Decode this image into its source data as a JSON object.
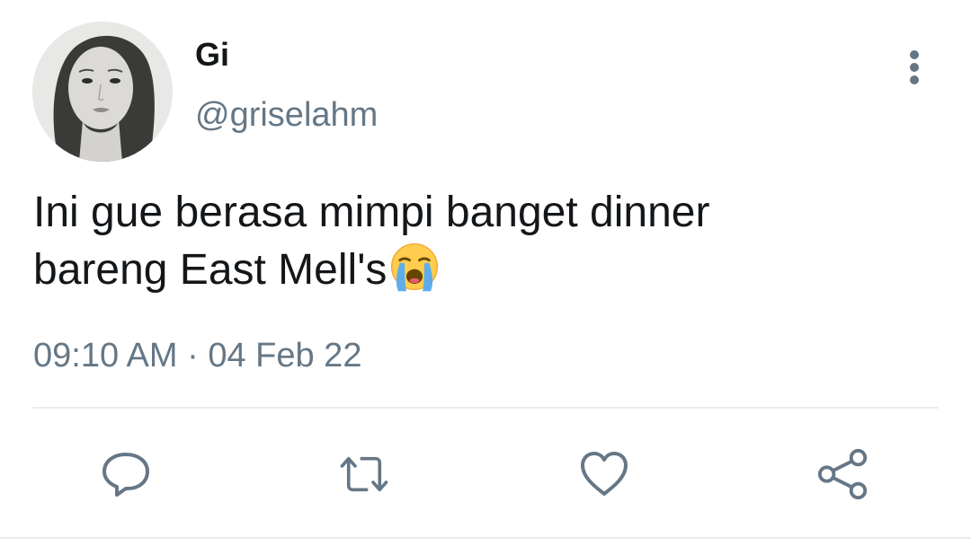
{
  "user": {
    "display_name": "Gi",
    "handle": "@griselahm"
  },
  "tweet": {
    "text_line1": "Ini gue berasa mimpi banget dinner",
    "text_line2": "bareng East Mell's",
    "emoji": "loudly-crying-face",
    "timestamp": "09:10 AM · 04 Feb 22"
  },
  "actions": [
    {
      "name": "reply",
      "icon": "speech-bubble-icon"
    },
    {
      "name": "retweet",
      "icon": "retweet-arrows-icon"
    },
    {
      "name": "like",
      "icon": "heart-icon"
    },
    {
      "name": "share",
      "icon": "share-nodes-icon"
    }
  ],
  "colors": {
    "text_primary": "#14171a",
    "text_secondary": "#657786",
    "divider": "#e6ecf0"
  }
}
